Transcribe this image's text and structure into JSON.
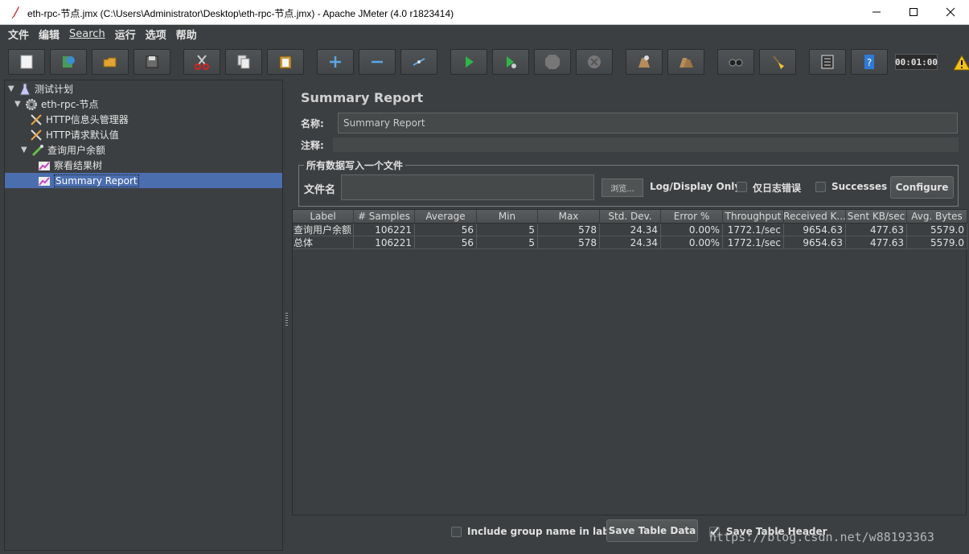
{
  "window": {
    "title": "eth-rpc-节点.jmx (C:\\Users\\Administrator\\Desktop\\eth-rpc-节点.jmx) - Apache JMeter (4.0 r1823414)"
  },
  "menu": [
    "文件",
    "编辑",
    "Search",
    "运行",
    "选项",
    "帮助"
  ],
  "toolbar": {
    "timer": "00:01:00",
    "buttons": [
      "new-icon",
      "templates-icon",
      "open-icon",
      "save-icon",
      "cut-icon",
      "copy-icon",
      "paste-icon",
      "expand-icon",
      "collapse-icon",
      "toggle-icon",
      "start-icon",
      "start-no-pause-icon",
      "stop-icon",
      "shutdown-icon",
      "clear-icon",
      "clear-all-icon",
      "search-icon",
      "reset-search-icon",
      "function-helper-icon",
      "help-icon"
    ]
  },
  "tree": {
    "plan": "测试计划",
    "thread_group": "eth-rpc-节点",
    "header_manager": "HTTP信息头管理器",
    "http_defaults": "HTTP请求默认值",
    "sampler": "查询用户余额",
    "results_tree": "察看结果树",
    "summary_report": "Summary Report"
  },
  "panel": {
    "title": "Summary Report",
    "name_label": "名称:",
    "name_value": "Summary Report",
    "comment_label": "注释:",
    "file_group_legend": "所有数据写入一个文件",
    "file_label": "文件名",
    "browse_label": "浏览...",
    "log_display_label": "Log/Display Only:",
    "errors_only_label": "仅日志错误",
    "successes_label": "Successes",
    "configure_label": "Configure"
  },
  "table": {
    "columns": [
      "Label",
      "# Samples",
      "Average",
      "Min",
      "Max",
      "Std. Dev.",
      "Error %",
      "Throughput",
      "Received K...",
      "Sent KB/sec",
      "Avg. Bytes"
    ],
    "rows": [
      [
        "查询用户余额",
        "106221",
        "56",
        "5",
        "578",
        "24.34",
        "0.00%",
        "1772.1/sec",
        "9654.63",
        "477.63",
        "5579.0"
      ],
      [
        "总体",
        "106221",
        "56",
        "5",
        "578",
        "24.34",
        "0.00%",
        "1772.1/sec",
        "9654.63",
        "477.63",
        "5579.0"
      ]
    ]
  },
  "bottom": {
    "include_group_label": "Include group name in label?",
    "save_table_data": "Save Table Data",
    "save_table_header": "Save Table Header"
  },
  "watermark": "https://blog.csdn.net/w88193363"
}
